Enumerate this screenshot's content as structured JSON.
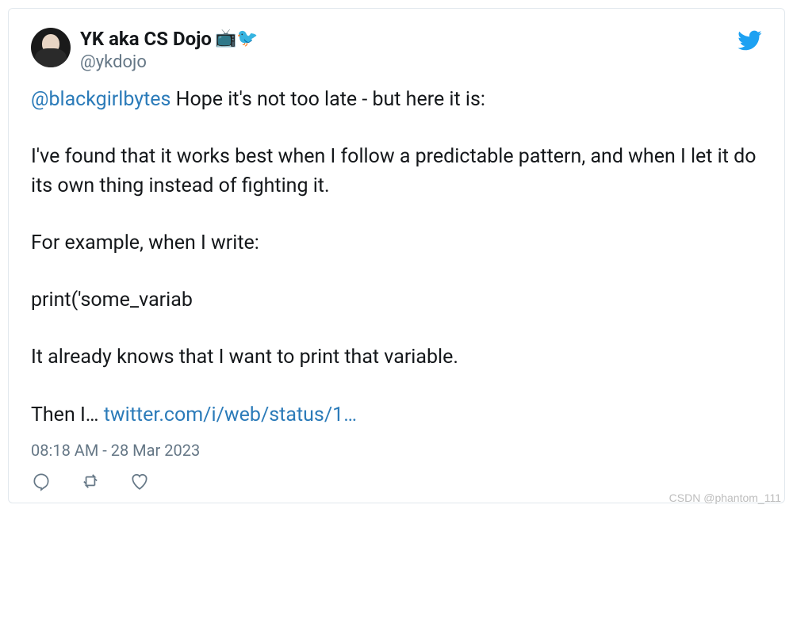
{
  "user": {
    "display_name": "YK aka CS Dojo",
    "emoji": "📺🐦",
    "handle": "@ykdojo"
  },
  "tweet": {
    "mention": "@blackgirlbytes",
    "text_1": " Hope it's not too late - but here it is:",
    "text_2": "I've found that it works best when I follow a predictable pattern, and when I let it do its own thing instead of fighting it.",
    "text_3": "For example, when I write:",
    "text_4": "print('some_variab",
    "text_5": "It already knows that I want to print that variable.",
    "text_6_prefix": "Then I… ",
    "link": "twitter.com/i/web/status/1…"
  },
  "timestamp": "08:18 AM - 28 Mar 2023",
  "watermark": "CSDN @phantom_111"
}
